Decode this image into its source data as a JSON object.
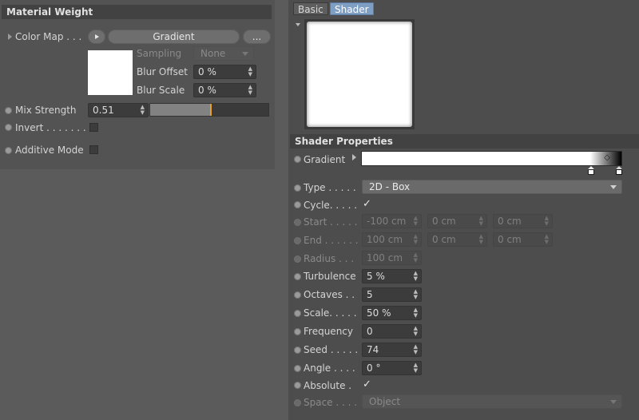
{
  "left_panel": {
    "header": "Material Weight",
    "color_map": {
      "label": "Color Map . . .",
      "shader_button": "Gradient",
      "more_button": "..."
    },
    "sampling": {
      "label": "Sampling",
      "value": "None"
    },
    "blur_offset": {
      "label": "Blur Offset",
      "value": "0 %"
    },
    "blur_scale": {
      "label": "Blur Scale",
      "value": "0 %"
    },
    "mix_strength": {
      "label": "Mix Strength",
      "value": "0.51",
      "slider_fraction": 0.51
    },
    "invert": {
      "label": "Invert . . . . . . .",
      "checked": false
    },
    "additive_mode": {
      "label": "Additive Mode",
      "checked": false
    }
  },
  "right_panel": {
    "tabs": [
      {
        "label": "Basic",
        "active": false
      },
      {
        "label": "Shader",
        "active": true
      }
    ],
    "section_header": "Shader Properties",
    "gradient": {
      "label": "Gradient"
    },
    "type": {
      "label": "Type . . . . .",
      "value": "2D - Box"
    },
    "cycle": {
      "label": "Cycle. . . . .",
      "checked": true
    },
    "start": {
      "label": "Start . . . . .",
      "values": [
        "-100 cm",
        "0 cm",
        "0 cm"
      ]
    },
    "end": {
      "label": "End . . . . . .",
      "values": [
        "100 cm",
        "0 cm",
        "0 cm"
      ]
    },
    "radius": {
      "label": "Radius . . .",
      "value": "100 cm"
    },
    "turbulence": {
      "label": "Turbulence",
      "value": "5 %"
    },
    "octaves": {
      "label": "Octaves . .",
      "value": "5"
    },
    "scale": {
      "label": "Scale. . . . .",
      "value": "50 %"
    },
    "frequency": {
      "label": "Frequency",
      "value": "0"
    },
    "seed": {
      "label": "Seed . . . . .",
      "value": "74"
    },
    "angle": {
      "label": "Angle . . . .",
      "value": "0 °"
    },
    "absolute": {
      "label": "Absolute .",
      "checked": true
    },
    "space": {
      "label": "Space . . . .",
      "value": "Object"
    }
  },
  "colors": {
    "slider_handle": "#e8a020",
    "panel": "#535353",
    "header": "#424242"
  }
}
